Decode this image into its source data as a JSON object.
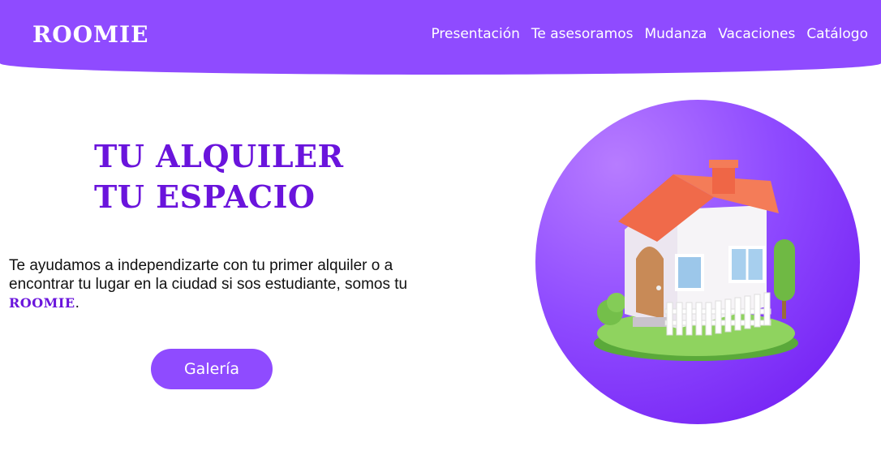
{
  "header": {
    "logo": "ROOMIE",
    "nav": [
      {
        "label": "Presentación"
      },
      {
        "label": "Te asesoramos"
      },
      {
        "label": "Mudanza"
      },
      {
        "label": "Vacaciones"
      },
      {
        "label": "Catálogo"
      }
    ]
  },
  "hero": {
    "title_line1": "TU ALQUILER",
    "title_line2": "TU ESPACIO",
    "description": "Te ayudamos a independizarte con tu primer alquiler o a encontrar tu lugar en la ciudad si sos estudiante, somos tu ",
    "brand": "ROOMIE",
    "description_end": ".",
    "button_label": "Galería"
  },
  "colors": {
    "brand_purple": "#8f4bff",
    "title_purple": "#6a14dc"
  },
  "image": {
    "subject": "house-illustration"
  }
}
